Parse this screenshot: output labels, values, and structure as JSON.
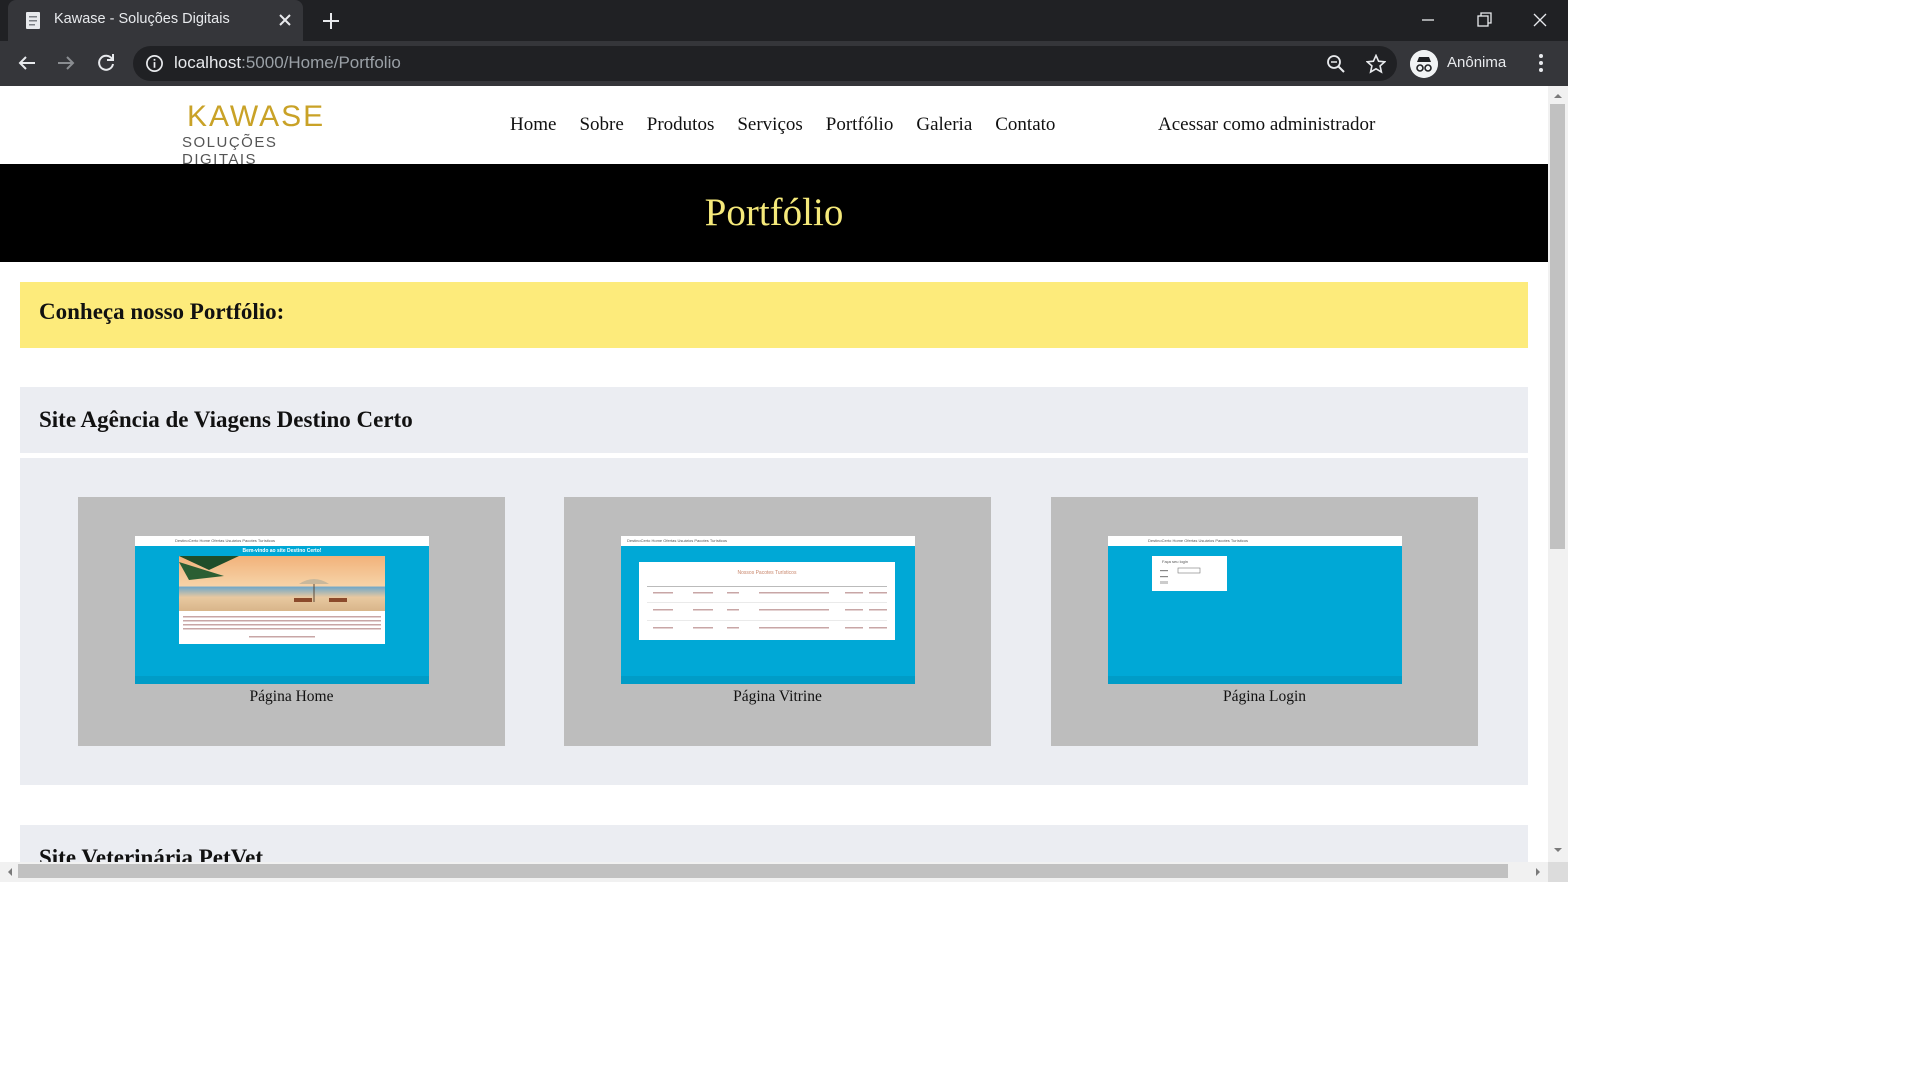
{
  "browser": {
    "tab_title": "Kawase - Soluções Digitais",
    "url_host": "localhost",
    "url_path": ":5000/Home/Portfolio",
    "profile_label": "Anônima",
    "icons": [
      "page-favicon",
      "close-icon",
      "new-tab-icon",
      "minimize-icon",
      "restore-icon",
      "close-window-icon",
      "back-icon",
      "forward-icon",
      "reload-icon",
      "info-icon",
      "zoom-icon",
      "star-icon",
      "incognito-icon",
      "more-menu-icon"
    ]
  },
  "site": {
    "logo_main": "KAWASE",
    "logo_sub": "SOLUÇÕES DIGITAIS",
    "nav": [
      "Home",
      "Sobre",
      "Produtos",
      "Serviços",
      "Portfólio",
      "Galeria",
      "Contato"
    ],
    "admin_link": "Acessar como administrador",
    "banner_title": "Portfólio",
    "intro": "Conheça nosso Portfólio:",
    "colors": {
      "banner_bg": "#000000",
      "banner_text": "#f5e97a",
      "intro_bg": "#fdeb7b",
      "card_bg": "#bdbdbd",
      "shot_bg": "#00a8d6",
      "section_bg": "#ebedf2"
    }
  },
  "projects": [
    {
      "title": "Site Agência de Viagens Destino Certo",
      "cards": [
        {
          "caption": "Página Home",
          "mini_nav": "DestinoCerto  Home  Ofertas  Usuários  Pacotes Turísticos",
          "mini_heading": "Bem-vindo ao site Destino Certo!"
        },
        {
          "caption": "Página Vitrine",
          "mini_nav": "DestinoCerto  Home  Ofertas  Usuários  Pacotes Turísticos",
          "mini_heading": "Nossos Pacotes Turísticos"
        },
        {
          "caption": "Página Login",
          "mini_nav": "DestinoCerto  Home  Ofertas  Usuários  Pacotes Turísticos",
          "mini_heading": "Faça seu login"
        }
      ]
    },
    {
      "title": "Site Veterinária PetVet"
    }
  ]
}
